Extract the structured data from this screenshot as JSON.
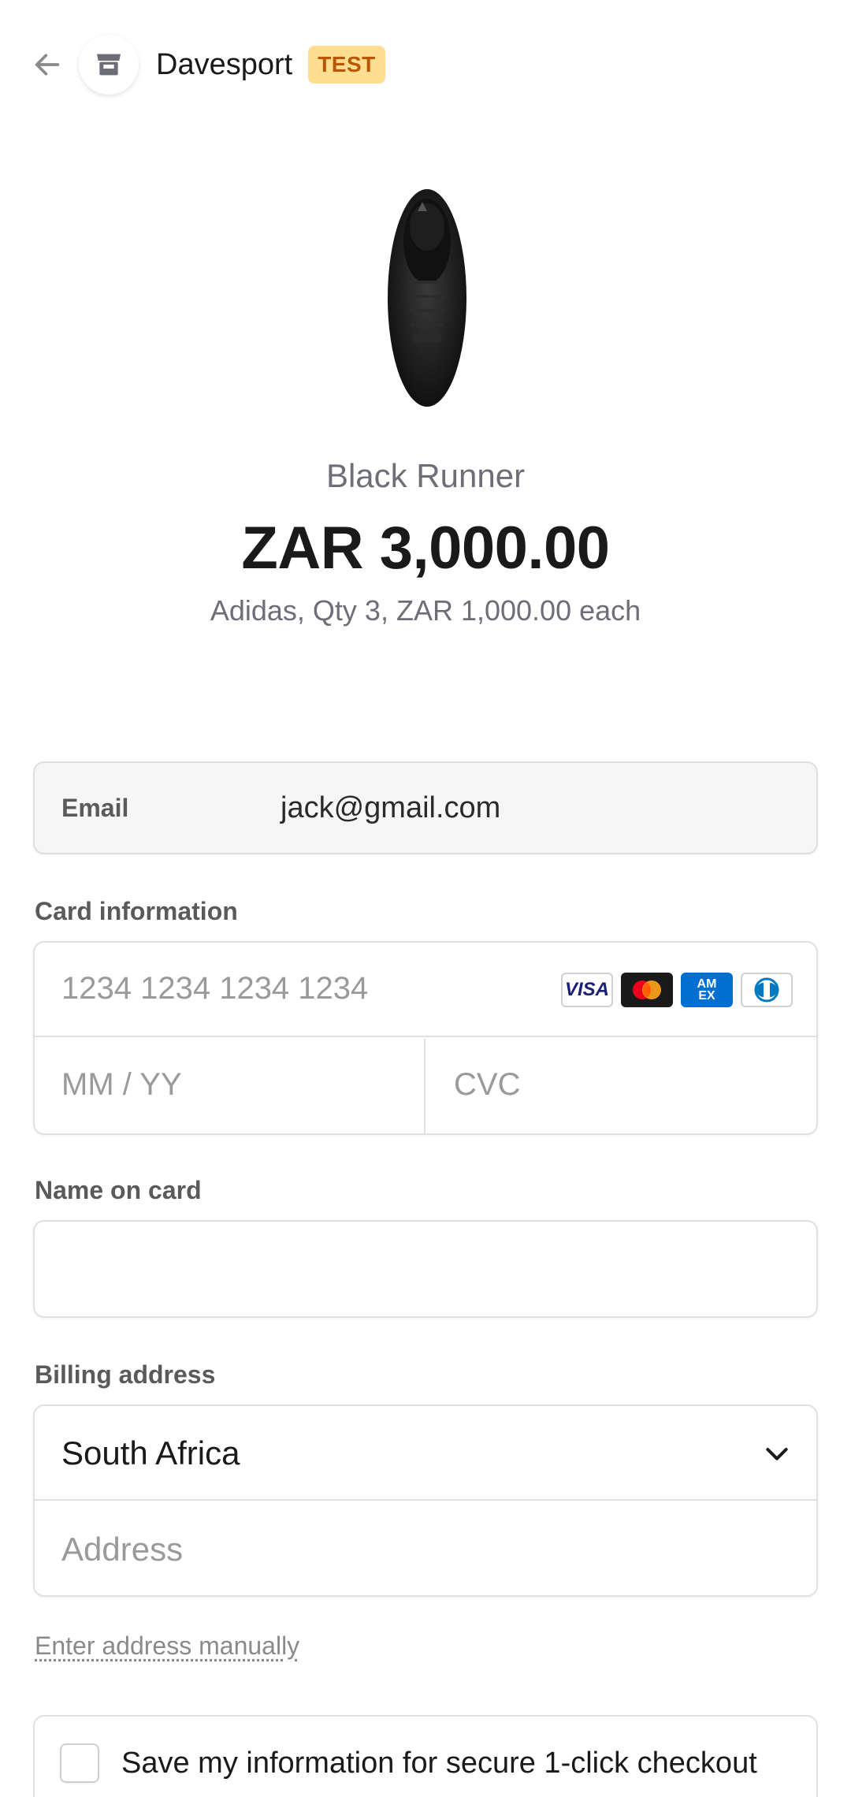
{
  "header": {
    "store_name": "Davesport",
    "badge": "TEST"
  },
  "product": {
    "name": "Black Runner",
    "price": "ZAR 3,000.00",
    "description": "Adidas, Qty 3, ZAR 1,000.00 each"
  },
  "email": {
    "label": "Email",
    "value": "jack@gmail.com"
  },
  "card": {
    "label": "Card information",
    "number_placeholder": "1234 1234 1234 1234",
    "expiry_placeholder": "MM / YY",
    "cvc_placeholder": "CVC",
    "brands": [
      "visa-icon",
      "mastercard-icon",
      "amex-icon",
      "diners-icon"
    ],
    "visa_text": "VISA",
    "amex_text": "AM EX"
  },
  "name_on_card": {
    "label": "Name on card",
    "value": ""
  },
  "billing": {
    "label": "Billing address",
    "country": "South Africa",
    "address_placeholder": "Address",
    "manual_link": "Enter address manually"
  },
  "save_info": {
    "label": "Save my information for secure 1-click checkout",
    "checked": false
  },
  "colors": {
    "badge_bg": "#ffde92",
    "badge_text": "#bb5504",
    "visa_blue": "#1a1f71",
    "amex_blue": "#016fd0"
  }
}
